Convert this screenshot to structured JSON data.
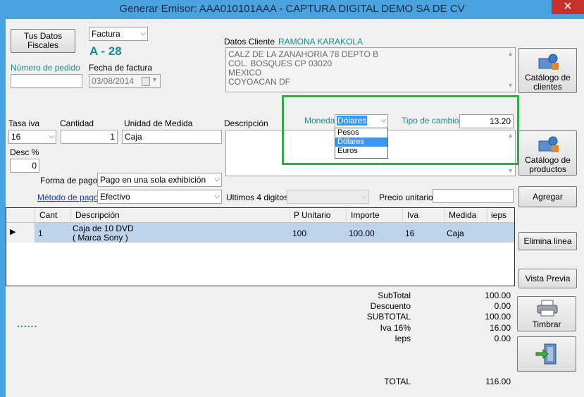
{
  "window": {
    "title": "Generar    Emisor: AAA010101AAA  -  CAPTURA DIGITAL DEMO SA DE CV",
    "close": "✕"
  },
  "header": {
    "tus_datos_btn": [
      "Tus Datos",
      "Fiscales"
    ],
    "doc_type": "Factura",
    "folio": "A - 28",
    "pedido_label": "Número de pedido",
    "pedido_value": "",
    "fecha_label": "Fecha de factura",
    "fecha_value": "03/08/2014"
  },
  "cliente": {
    "label": "Datos Cliente",
    "name": "RAMONA KARAKOLA",
    "address": [
      "CALZ DE LA ZANAHORIA 78 DEPTO B",
      "COL. BOSQUES   CP 03020",
      "MEXICO",
      "COYOACAN   DF"
    ]
  },
  "buttons": {
    "catalogo_clientes": [
      "Catálogo de",
      "clientes"
    ],
    "catalogo_productos": [
      "Catálogo de",
      "productos"
    ],
    "agregar": "Agregar",
    "elimina": "Elimina linea",
    "vista": "Vista Previa",
    "timbrar": "Timbrar"
  },
  "item": {
    "tasa_label": "Tasa iva",
    "tasa_value": "16",
    "cantidad_label": "Cantidad",
    "cantidad_value": "1",
    "unidad_label": "Unidad de Medida",
    "unidad_value": "Caja",
    "descripcion_label": "Descripción",
    "desc_label": "Desc %",
    "desc_value": "0",
    "forma_label": "Forma de pago",
    "forma_value": "Pago en una sola exhibición",
    "metodo_label": "Método de pago",
    "metodo_value": "Efectivo",
    "ultimos_label": "Ultimos 4 digitos",
    "precio_label": "Precio unitario",
    "precio_value": ""
  },
  "moneda": {
    "label": "Moneda",
    "selected": "Dólares",
    "options": [
      "Pesos",
      "Dólares",
      "Euros"
    ],
    "tipo_label": "Tipo de cambio",
    "tipo_value": "13.20"
  },
  "grid": {
    "columns": [
      "Cant",
      "Descripción",
      "P Unitario",
      "Importe",
      "Iva",
      "Medida",
      "ieps"
    ],
    "row": {
      "cant": "1",
      "desc1": "Caja de 10 DVD",
      "desc2": "( Marca Sony )",
      "punit": "100",
      "importe": "100.00",
      "iva": "16",
      "medida": "Caja",
      "ieps": ""
    },
    "row_marker": "▶"
  },
  "totals": {
    "labels": [
      "SubTotal",
      "Descuento",
      "SUBTOTAL",
      "Iva 16%",
      "Ieps"
    ],
    "values": [
      "100.00",
      "0.00",
      "100.00",
      "16.00",
      "0.00"
    ],
    "total_label": "TOTAL",
    "total_value": "116.00"
  },
  "progress_dots": "......"
}
